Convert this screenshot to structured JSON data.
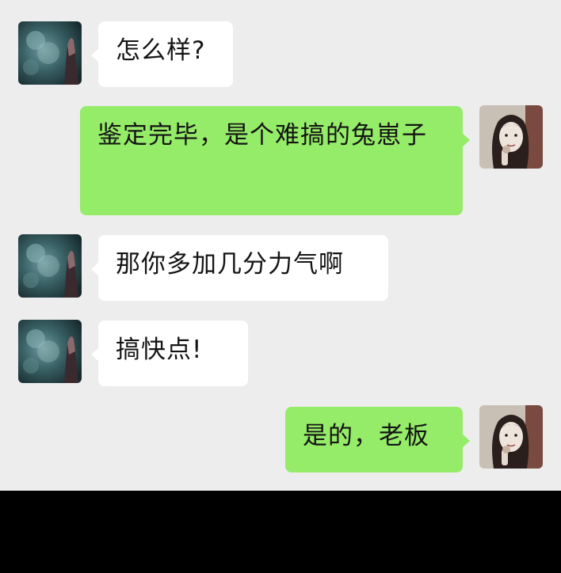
{
  "messages": [
    {
      "sender": "contact",
      "text": "怎么样?"
    },
    {
      "sender": "self",
      "text": "鉴定完毕，是个难搞的兔崽子"
    },
    {
      "sender": "contact",
      "text": "那你多加几分力气啊"
    },
    {
      "sender": "contact",
      "text": "搞快点!"
    },
    {
      "sender": "self",
      "text": "是的，老板"
    }
  ],
  "colors": {
    "chat_background": "#ededed",
    "incoming_bubble": "#ffffff",
    "outgoing_bubble": "#95ec69",
    "bottom_bar": "#000000"
  },
  "icons": {
    "contact_avatar": "dark-teal-landscape-avatar",
    "self_avatar": "woman-portrait-sketch-avatar"
  }
}
